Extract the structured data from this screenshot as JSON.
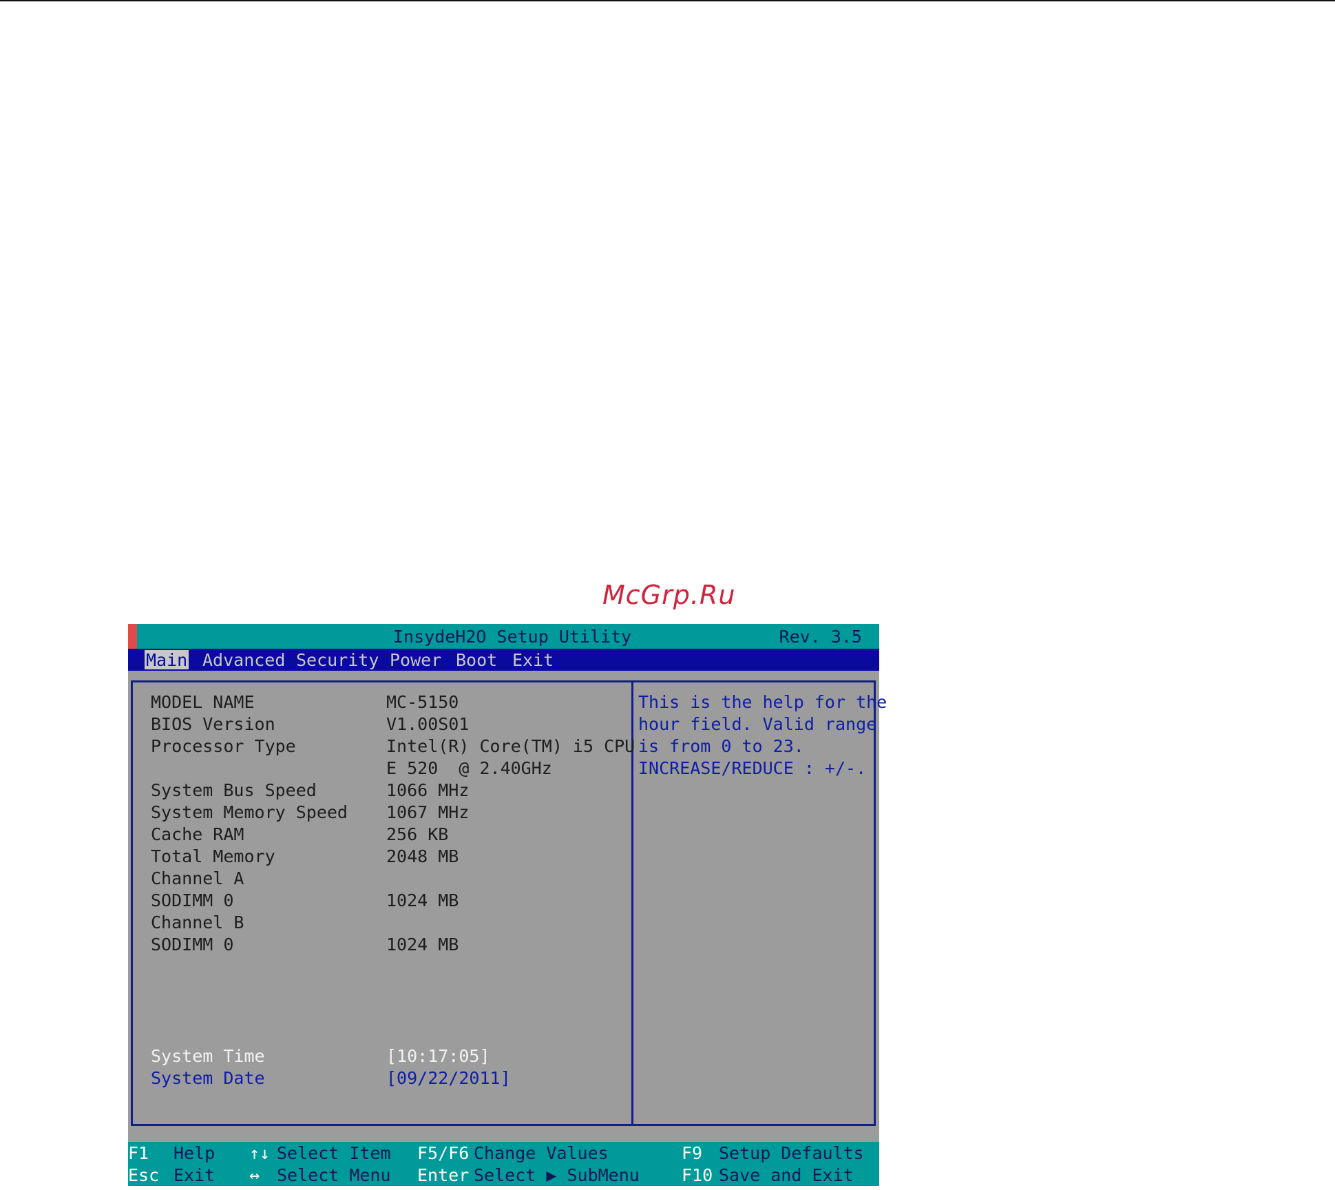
{
  "watermark": "McGrp.Ru",
  "bios": {
    "title": "InsydeH2O Setup Utility",
    "rev": "Rev. 3.5",
    "tabs": [
      "Main",
      "Advanced",
      "Security",
      "Power",
      "Boot",
      "Exit"
    ],
    "active_tab": "Main",
    "info": [
      {
        "label": "MODEL NAME",
        "value": "MC-5150"
      },
      {
        "label": "BIOS Version",
        "value": "V1.00S01"
      },
      {
        "label": "Processor Type",
        "value": "Intel(R) Core(TM) i5 CPU"
      },
      {
        "label": "",
        "value": "E 520  @ 2.40GHz"
      },
      {
        "label": "System Bus Speed",
        "value": "1066 MHz"
      },
      {
        "label": "System Memory Speed",
        "value": "1067 MHz"
      },
      {
        "label": "Cache RAM",
        "value": "256 KB"
      },
      {
        "label": "Total Memory",
        "value": "2048 MB"
      },
      {
        "label": "Channel A",
        "value": ""
      },
      {
        "label": "SODIMM 0",
        "value": "1024 MB"
      },
      {
        "label": "Channel B",
        "value": ""
      },
      {
        "label": "SODIMM 0",
        "value": "1024 MB"
      }
    ],
    "system_time": {
      "label": "System Time",
      "value": "[10:17:05]"
    },
    "system_date": {
      "label": "System Date",
      "value": "[09/22/2011]"
    },
    "help_lines": [
      "This is the help for the",
      "hour field. Valid range",
      "is from 0 to 23.",
      "INCREASE/REDUCE : +/-."
    ],
    "footer": {
      "row1": [
        {
          "key": "F1",
          "action": "Help"
        },
        {
          "key": "↑↓",
          "action": "Select Item"
        },
        {
          "key": "F5/F6",
          "action": "Change Values"
        },
        {
          "key": "F9",
          "action": "Setup Defaults"
        }
      ],
      "row2": [
        {
          "key": "Esc",
          "action": "Exit"
        },
        {
          "key": "↔",
          "action": "Select Menu"
        },
        {
          "key": "Enter",
          "action": "Select ▶ SubMenu"
        },
        {
          "key": "F10",
          "action": "Save and Exit"
        }
      ]
    }
  }
}
